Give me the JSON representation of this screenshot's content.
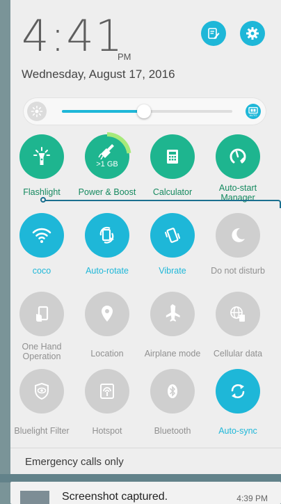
{
  "header": {
    "time": "4:41",
    "ampm": "PM",
    "date": "Wednesday, August 17, 2016",
    "edit_icon": "edit-note-icon",
    "settings_icon": "gear-icon"
  },
  "brightness": {
    "level": 0.48,
    "auto_label": "AUTO"
  },
  "tiles": [
    {
      "label": "Flashlight",
      "icon": "flashlight-icon",
      "state": "green"
    },
    {
      "label": "Power & Boost",
      "icon": "boost-broom-icon",
      "state": "green",
      "badge": ">1 GB"
    },
    {
      "label": "Calculator",
      "icon": "calculator-icon",
      "state": "green"
    },
    {
      "label": "Auto-start Manager",
      "icon": "auto-start-icon",
      "state": "green"
    },
    {
      "label": "coco",
      "icon": "wifi-icon",
      "state": "blue"
    },
    {
      "label": "Auto-rotate",
      "icon": "auto-rotate-icon",
      "state": "blue"
    },
    {
      "label": "Vibrate",
      "icon": "vibrate-icon",
      "state": "blue"
    },
    {
      "label": "Do not disturb",
      "icon": "moon-icon",
      "state": "grey"
    },
    {
      "label": "One Hand Operation",
      "icon": "one-hand-icon",
      "state": "grey"
    },
    {
      "label": "Location",
      "icon": "location-pin-icon",
      "state": "grey"
    },
    {
      "label": "Airplane mode",
      "icon": "airplane-icon",
      "state": "grey"
    },
    {
      "label": "Cellular data",
      "icon": "globe-data-icon",
      "state": "grey"
    },
    {
      "label": "Bluelight Filter",
      "icon": "eye-shield-icon",
      "state": "grey"
    },
    {
      "label": "Hotspot",
      "icon": "hotspot-icon",
      "state": "grey"
    },
    {
      "label": "Bluetooth",
      "icon": "bluetooth-icon",
      "state": "grey"
    },
    {
      "label": "Auto-sync",
      "icon": "sync-icon",
      "state": "blue"
    }
  ],
  "status": {
    "emergency": "Emergency calls only"
  },
  "notification": {
    "title": "Screenshot captured.",
    "time": "4:39 PM"
  },
  "colors": {
    "accent_blue": "#1eb7d8",
    "accent_green": "#1eb58f",
    "inactive_grey": "#cfcfcf"
  }
}
